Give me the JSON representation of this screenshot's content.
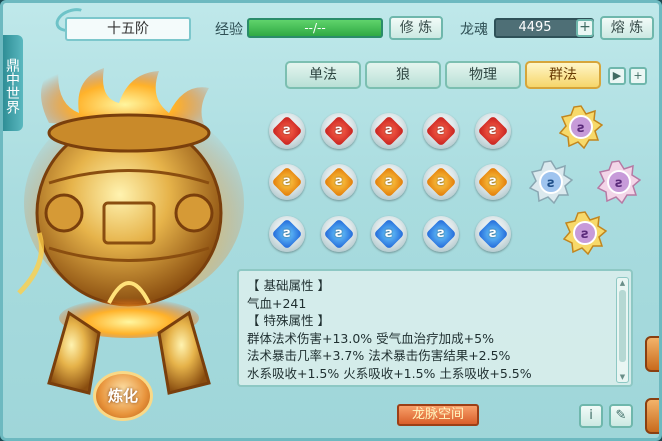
{
  "side_tab": "鼎中世界",
  "header": {
    "tier": "十五阶",
    "exp_label": "经验",
    "exp_value": "--/--",
    "cultivate_button": "修 炼",
    "soul_label": "龙魂",
    "soul_value": "4495",
    "smelt_button": "熔 炼"
  },
  "tabs": [
    {
      "label": "单法",
      "active": false
    },
    {
      "label": "狼",
      "active": false
    },
    {
      "label": "物理",
      "active": false
    },
    {
      "label": "群法",
      "active": true
    }
  ],
  "gem_glyph": "ƨ",
  "gems": {
    "row1": [
      "red",
      "red",
      "red",
      "red",
      "red"
    ],
    "row2": [
      "orange",
      "orange",
      "orange",
      "orange",
      "orange"
    ],
    "row3": [
      "blue",
      "blue",
      "blue",
      "blue",
      "blue"
    ]
  },
  "info": {
    "section_basic": "【 基础属性 】",
    "basic_1": "气血+241",
    "section_special": "【 特殊属性 】",
    "line_1": "群体法术伤害+13.0%  受气血治疗加成+5%",
    "line_2": "法术暴击几率+3.7%  法术暴击伤害结果+2.5%",
    "line_3": "水系吸收+1.5%  火系吸收+1.5%  土系吸收+5.5%"
  },
  "refine_button": "炼化",
  "space_button": "龙脉空间",
  "info_icon": "i",
  "edit_icon": "✎",
  "colors": {
    "accent_gold": "#f6d66a",
    "exp_green": "#2fa944",
    "panel_teal": "#a9dcdf"
  }
}
